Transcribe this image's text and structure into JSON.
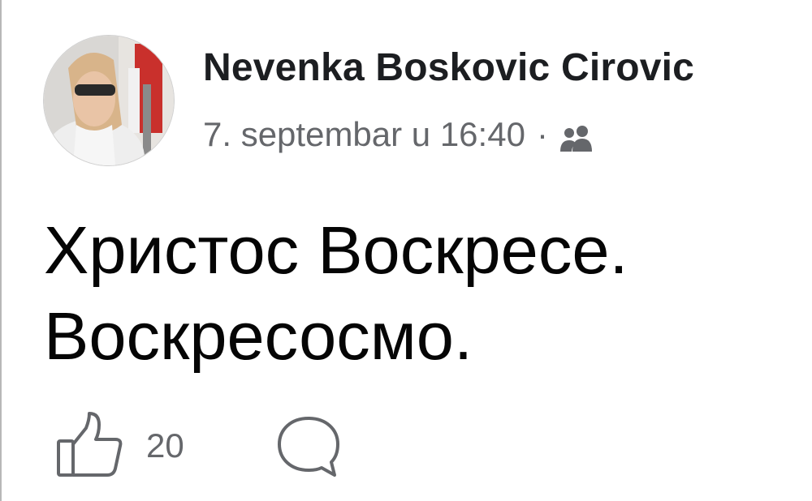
{
  "post": {
    "author": "Nevenka Boskovic Cirovic",
    "timestamp": "7. septembar u 16:40",
    "separator": "·",
    "audience_icon": "friends-icon",
    "text_lines": [
      "Христос Воскресе.",
      "Воскресосмо."
    ],
    "reactions": {
      "like_icon": "thumbs-up-icon",
      "like_count": "20",
      "comment_icon": "comment-bubble-icon"
    }
  },
  "colors": {
    "name": "#1c1e21",
    "meta": "#65676b",
    "body_text": "#050505",
    "icon_stroke": "#65676b"
  }
}
